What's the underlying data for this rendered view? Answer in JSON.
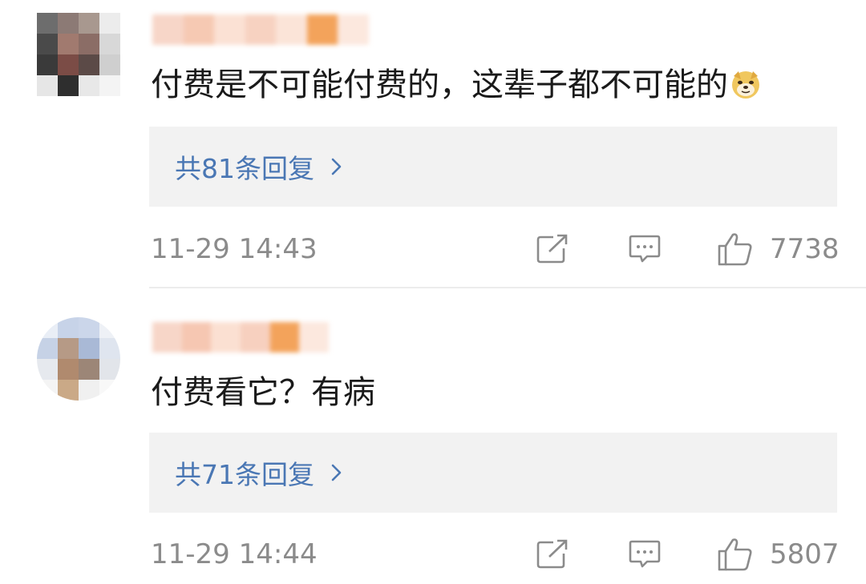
{
  "comments": [
    {
      "text": "付费是不可能付费的，这辈子都不可能的",
      "emoji": "doge-emoji",
      "replies_label": "共81条回复",
      "time": "11-29 14:43",
      "like_count": "7738"
    },
    {
      "text": "付费看它？有病",
      "emoji": "",
      "replies_label": "共71条回复",
      "time": "11-29 14:44",
      "like_count": "5807"
    }
  ],
  "icons": {
    "share": "share-icon",
    "reply": "comment-icon",
    "like": "thumbs-up-icon",
    "chevron": "chevron-right-icon"
  },
  "colors": {
    "link": "#4a77b4",
    "meta": "#8b8b8b",
    "text": "#1a1a1a",
    "reply_bg": "#f2f2f2"
  }
}
